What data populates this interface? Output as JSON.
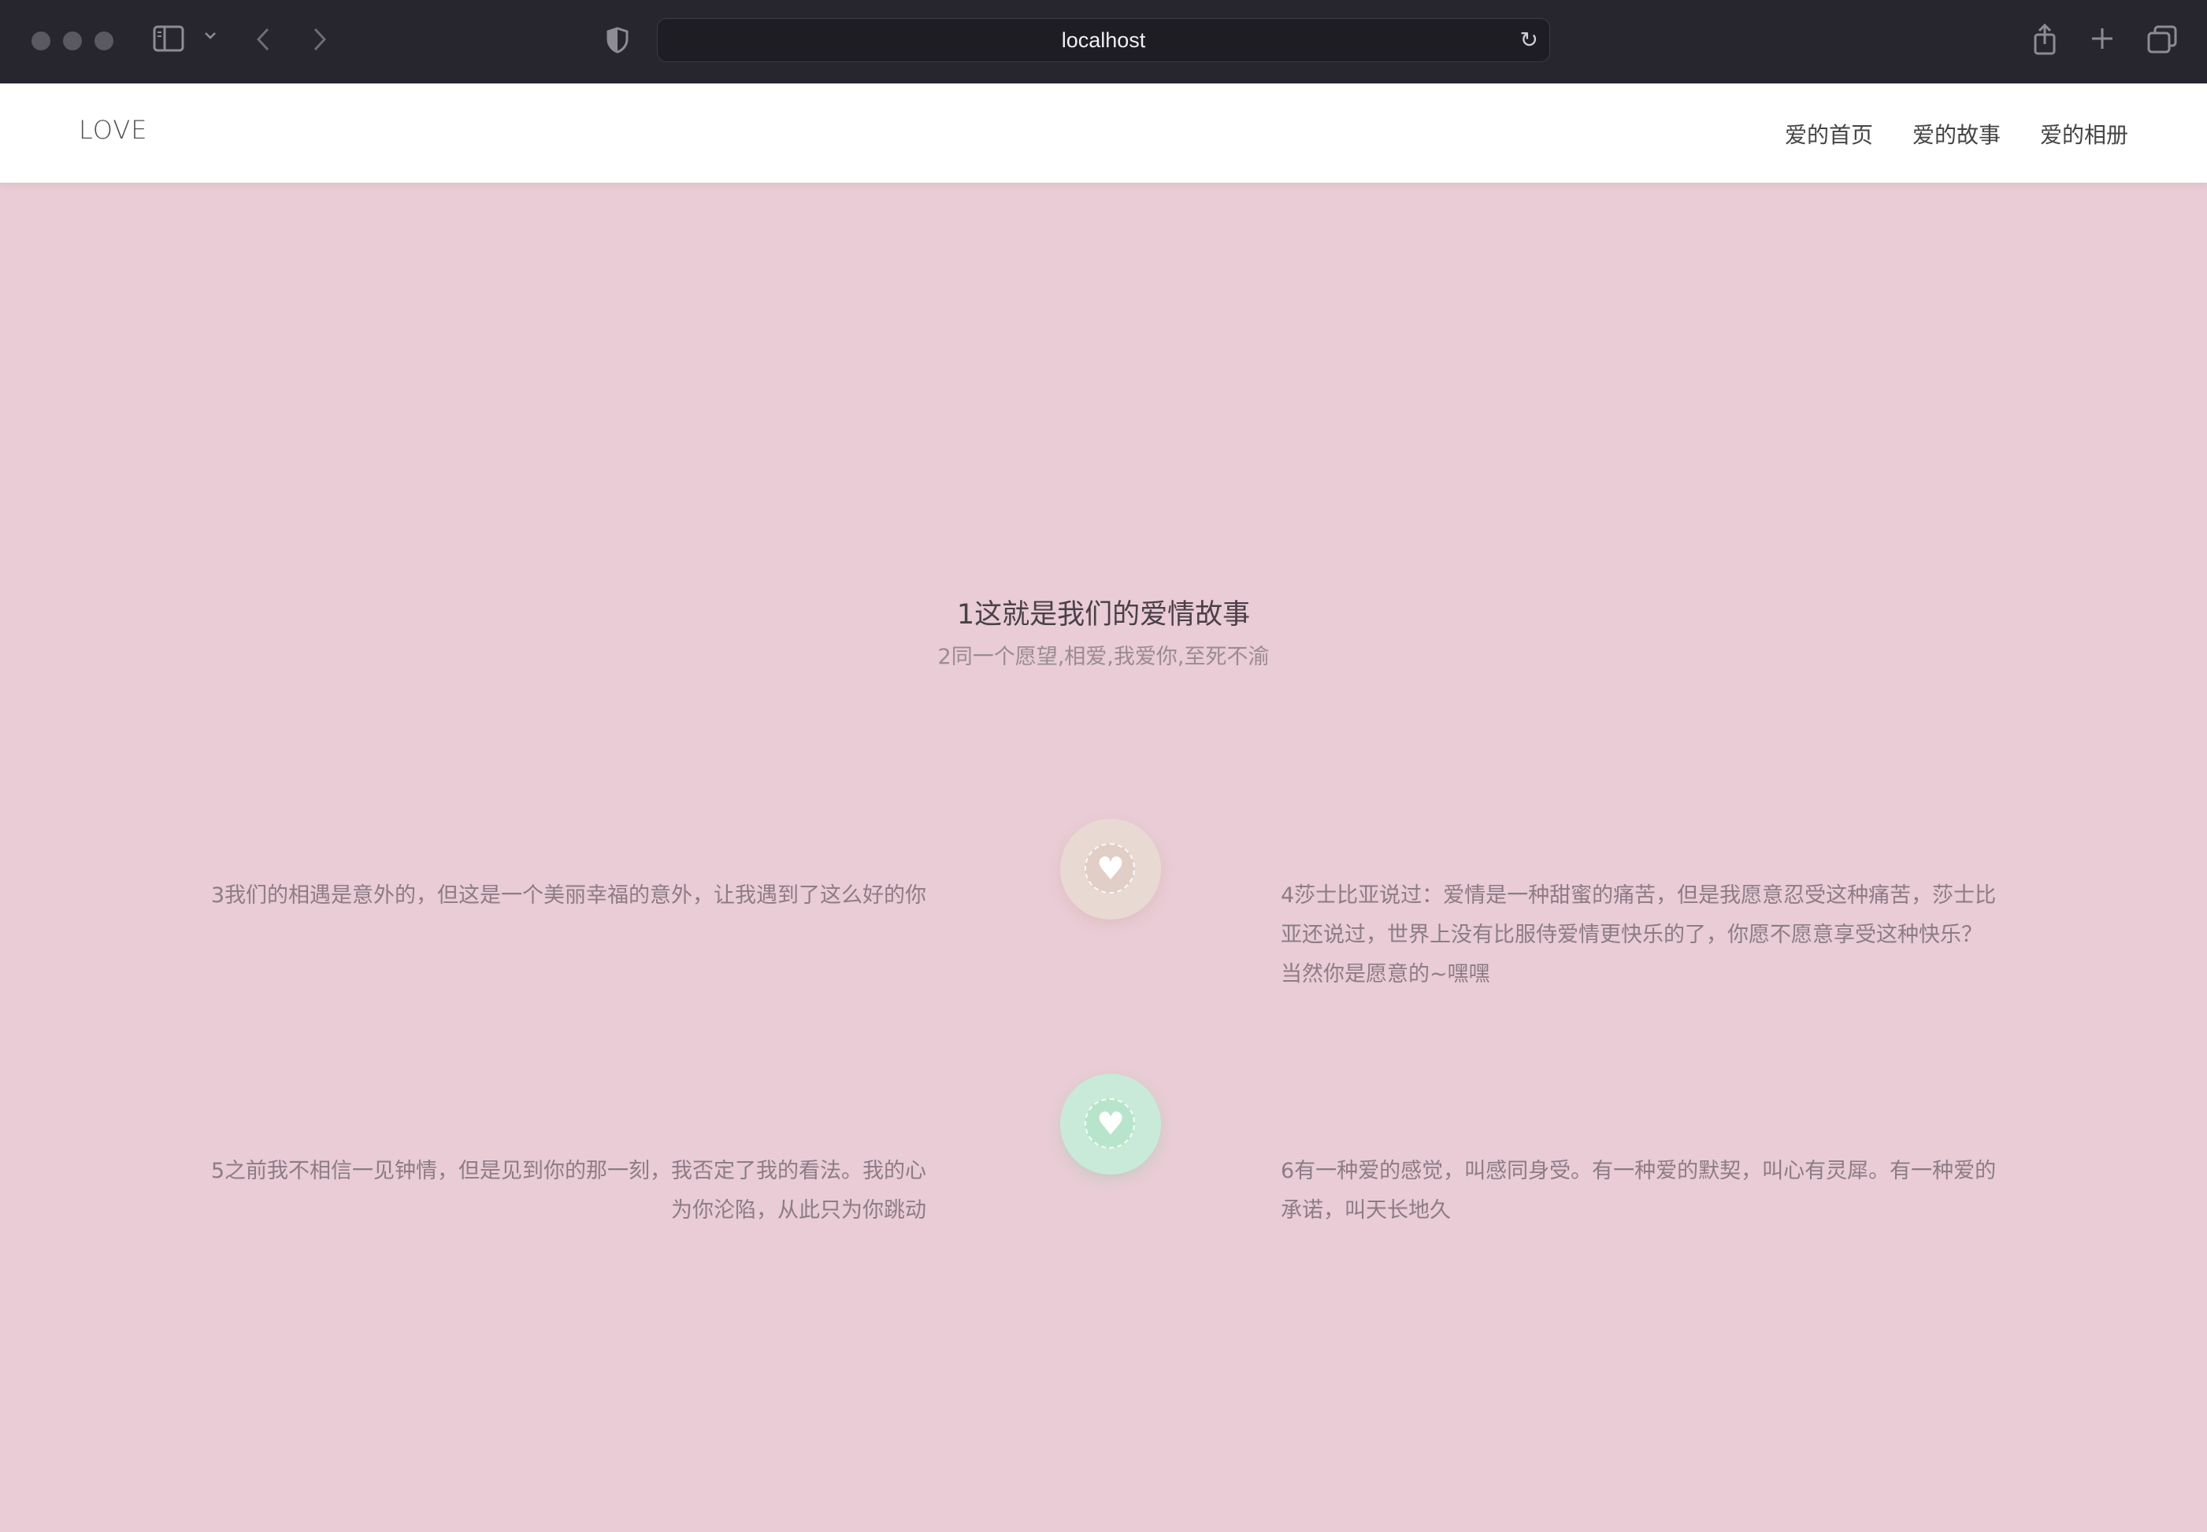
{
  "browser": {
    "url": "localhost"
  },
  "site": {
    "logo": "LOVE",
    "nav": [
      "爱的首页",
      "爱的故事",
      "爱的相册"
    ]
  },
  "hero": {
    "title": "1这就是我们的爱情故事",
    "subtitle": "2同一个愿望,相爱,我爱你,至死不渝"
  },
  "stories": {
    "s3": "3我们的相遇是意外的，但这是一个美丽幸福的意外，让我遇到了这么好的你",
    "s4": "4莎士比亚说过：爱情是一种甜蜜的痛苦，但是我愿意忍受这种痛苦，莎士比亚还说过，世界上没有比服侍爱情更快乐的了，你愿不愿意享受这种快乐？当然你是愿意的~嘿嘿",
    "s5": "5之前我不相信一见钟情，但是见到你的那一刻，我否定了我的看法。我的心为你沦陷，从此只为你跳动",
    "s6": "6有一种爱的感觉，叫感同身受。有一种爱的默契，叫心有灵犀。有一种爱的承诺，叫天长地久"
  },
  "colors": {
    "page_bg": "#e9ccd5",
    "badge_beige": "#e8dad3",
    "badge_mint": "#c9ead8"
  },
  "icons": [
    "heart-icon",
    "reload-icon",
    "share-icon",
    "new-tab-icon",
    "tabs-overview-icon",
    "sidebar-icon",
    "back-icon",
    "forward-icon",
    "shield-icon"
  ]
}
